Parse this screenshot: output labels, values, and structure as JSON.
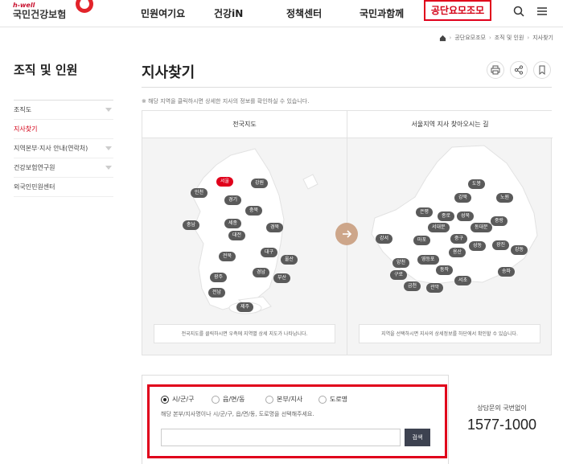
{
  "header": {
    "logo_small": "h-well",
    "logo_main": "국민건강보험",
    "nav": [
      "민원여기요",
      "건강iN",
      "정책센터",
      "국민과함께"
    ],
    "nav_highlight": "공단요모조모",
    "search_icon": "search-icon",
    "menu_icon": "menu-icon"
  },
  "breadcrumb": {
    "home_icon": "home-icon",
    "items": [
      "공단요모조모",
      "조직 및 인원",
      "지사찾기"
    ]
  },
  "lnb": {
    "title": "조직 및 인원",
    "items": [
      {
        "label": "조직도",
        "expand": true,
        "active": false
      },
      {
        "label": "지사찾기",
        "expand": false,
        "active": true
      },
      {
        "label": "지역본부·지사 안내(연락처)",
        "expand": true,
        "active": false
      },
      {
        "label": "건강보험연구원",
        "expand": true,
        "active": false
      },
      {
        "label": "외국인민원센터",
        "expand": false,
        "active": false
      }
    ]
  },
  "page": {
    "title": "지사찾기",
    "note": "※ 해당 지역을 클릭하시면 상세한 지사의 정보를 확인하실 수 있습니다.",
    "tool_icons": [
      "print-icon",
      "share-icon",
      "bookmark-icon"
    ]
  },
  "maps": {
    "left_title": "전국지도",
    "left_foot": "전국지도를 클릭하시면 우측에 지역별 상세 지도가 나타납니다.",
    "right_title": "서울지역 지사 찾아오시는 길",
    "right_foot": "지역을 선택하시면 지사의 상세정보를 하단에서 확인할 수 있습니다.",
    "national_regions": [
      "서울",
      "강원",
      "인천",
      "경기",
      "충북",
      "충남",
      "세종",
      "대전",
      "경북",
      "대구",
      "울산",
      "전북",
      "경남",
      "부산",
      "광주",
      "전남",
      "제주"
    ],
    "selected_region": "서울",
    "seoul_regions": [
      "도봉",
      "강북",
      "노원",
      "은평",
      "종로",
      "성북",
      "중랑",
      "서대문",
      "동대문",
      "강서",
      "마포",
      "중구",
      "성동",
      "광진",
      "강동",
      "용산",
      "양천",
      "영등포",
      "동작",
      "구로",
      "서초",
      "송파",
      "금천",
      "관악"
    ]
  },
  "search": {
    "options": [
      "시/군/구",
      "읍/면/동",
      "본부/지사",
      "도로명"
    ],
    "selected": 0,
    "hint": "해당 본부/지사명이나 시/군/구, 읍/면/동, 도로명을 선택해주세요.",
    "input_value": "",
    "button": "검색"
  },
  "contact": {
    "label": "상담문의 국번없이",
    "number": "1577-1000"
  }
}
